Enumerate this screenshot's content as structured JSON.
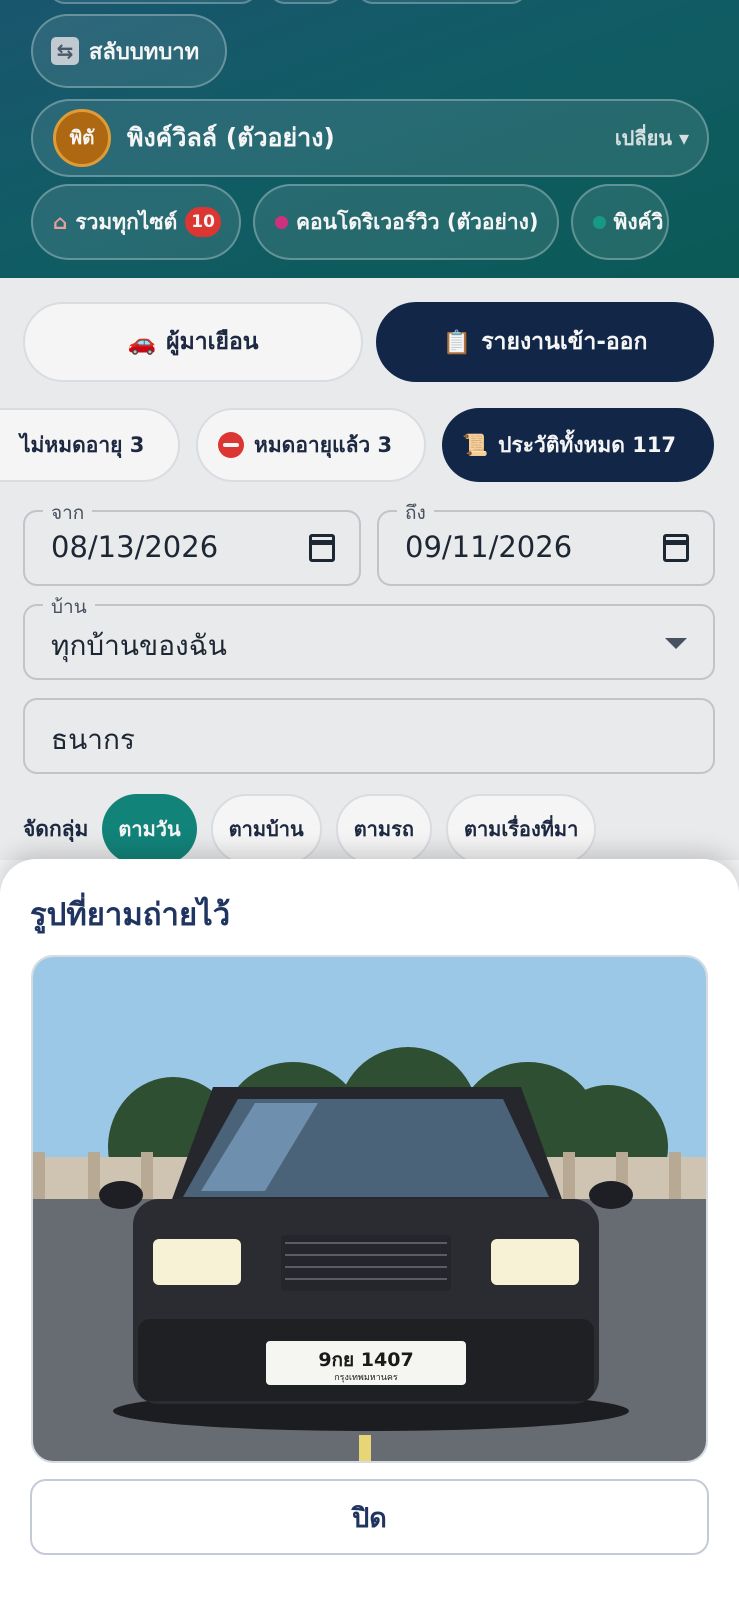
{
  "header": {
    "role_switch_label": "สลับบทบาท",
    "site": {
      "avatar_text": "พิตั",
      "name": "พิงค์วิลล์ (ตัวอย่าง)",
      "change_label": "เปลี่ยน ▾",
      "avatar_color": "#b56d12"
    },
    "site_chips": [
      {
        "label": "รวมทุกไซต์",
        "badge": "10"
      },
      {
        "label": "คอนโดริเวอร์วิว (ตัวอย่าง)",
        "dot_color": "#d63384"
      },
      {
        "label": "พิงค์วิ",
        "dot_color": "#1aa08c"
      }
    ]
  },
  "tabs": {
    "visitors": {
      "icon": "🚗",
      "label": "ผู้มาเยือน"
    },
    "report": {
      "icon": "📋",
      "label": "รายงานเข้า-ออก"
    }
  },
  "filters": [
    {
      "label": "ไม่หมดอายุ 3"
    },
    {
      "label": "หมดอายุแล้ว 3"
    },
    {
      "icon": "📜",
      "label": "ประวัติทั้งหมด 117"
    }
  ],
  "date_from": {
    "label": "จาก",
    "value": "08/13/2026"
  },
  "date_to": {
    "label": "ถึง",
    "value": "09/11/2026"
  },
  "house_select": {
    "label": "บ้าน",
    "value": "ทุกบ้านของฉัน"
  },
  "search": {
    "value": "ธนากร"
  },
  "group_by": {
    "label": "จัดกลุ่ม",
    "options": [
      "ตามวัน",
      "ตามบ้าน",
      "ตามรถ",
      "ตามเรื่องที่มา"
    ],
    "selected": "ตามวัน"
  },
  "sheet": {
    "title": "รูปที่ยามถ่ายไว้",
    "plate_number": "9กย 1407",
    "plate_province": "กรุงเทพมหานคร",
    "close_label": "ปิด"
  },
  "colors": {
    "navy": "#13294b",
    "teal": "#13897e",
    "title_blue": "#1f3460"
  }
}
